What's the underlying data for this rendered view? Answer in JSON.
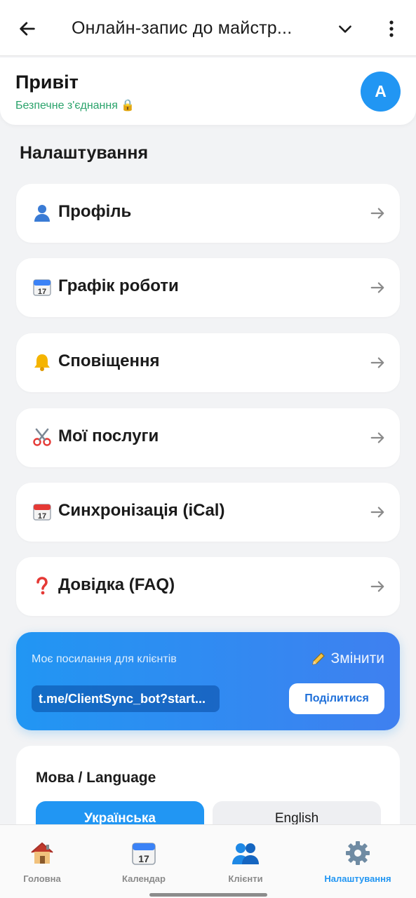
{
  "header": {
    "title": "Онлайн-запис до майстр...",
    "back_icon": "arrow-left-icon",
    "dropdown_icon": "chevron-down-icon",
    "more_icon": "more-vertical-icon"
  },
  "greeting": {
    "title": "Привіт",
    "secure_text": "Безпечне з'єднання 🔒",
    "avatar_letter": "A"
  },
  "settings": {
    "title": "Налаштування",
    "items": [
      {
        "icon": "👤",
        "icon_name": "profile-icon",
        "label": "Профіль"
      },
      {
        "icon": "📅",
        "icon_name": "calendar-icon",
        "label": "Графік роботи"
      },
      {
        "icon": "🔔",
        "icon_name": "bell-icon",
        "label": "Сповіщення"
      },
      {
        "icon": "✂️",
        "icon_name": "scissors-icon",
        "label": "Мої послуги"
      },
      {
        "icon": "📅",
        "icon_name": "calendar-sync-icon",
        "label": " Синхронізація (iCal)"
      },
      {
        "icon": "❓",
        "icon_name": "question-icon",
        "label": "Довідка (FAQ)"
      }
    ]
  },
  "client_link": {
    "caption": "Моє посилання для клієнтів",
    "edit_label": "Змінити",
    "url": "t.me/ClientSync_bot?start...",
    "share_label": "Поділитися"
  },
  "language": {
    "title": "Мова / Language",
    "options": [
      {
        "label": "Українська",
        "selected": true
      },
      {
        "label": "English",
        "selected": false
      }
    ]
  },
  "bottom_nav": [
    {
      "label": "Головна",
      "icon": "house-icon",
      "active": false
    },
    {
      "label": "Календар",
      "icon": "calendar-icon",
      "active": false
    },
    {
      "label": "Клієнти",
      "icon": "users-icon",
      "active": false
    },
    {
      "label": "Налаштування",
      "icon": "gear-icon",
      "active": true
    }
  ],
  "colors": {
    "accent": "#2196f3",
    "secure_green": "#2aa36b",
    "background": "#f2f3f5"
  }
}
